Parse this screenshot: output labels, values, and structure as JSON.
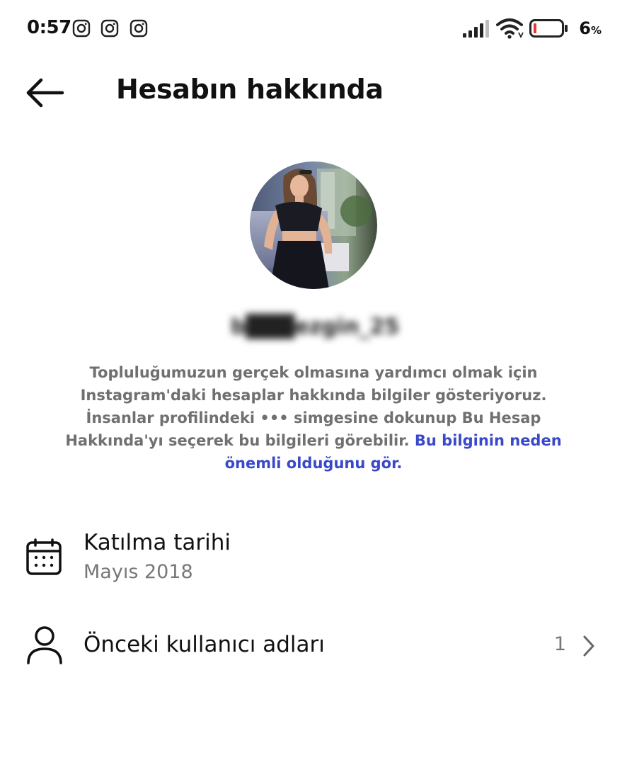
{
  "status_bar": {
    "time": "0:57",
    "battery_percent": "6",
    "battery_unit": "%",
    "notification_icons": [
      "instagram-icon",
      "instagram-icon",
      "instagram-icon"
    ]
  },
  "header": {
    "title": "Hesabın hakkında"
  },
  "profile": {
    "username": "b███ezgin_25"
  },
  "info": {
    "line1": "Topluluğumuzun gerçek olmasına yardımcı olmak için",
    "line2": "Instagram'daki hesaplar hakkında bilgiler gösteriyoruz.",
    "line3": "İnsanlar profilindeki ••• simgesine dokunup Bu Hesap",
    "line4": "Hakkında'yı seçerek bu bilgileri görebilir.",
    "link_part1": "Bu bilginin neden",
    "link_part2": "önemli olduğunu gör."
  },
  "rows": {
    "joined": {
      "title": "Katılma tarihi",
      "value": "Mayıs 2018"
    },
    "former_usernames": {
      "title": "Önceki kullanıcı adları",
      "count": "1"
    }
  },
  "colors": {
    "link": "#3949c9",
    "secondary_text": "#707070",
    "battery_low": "#e53935"
  }
}
